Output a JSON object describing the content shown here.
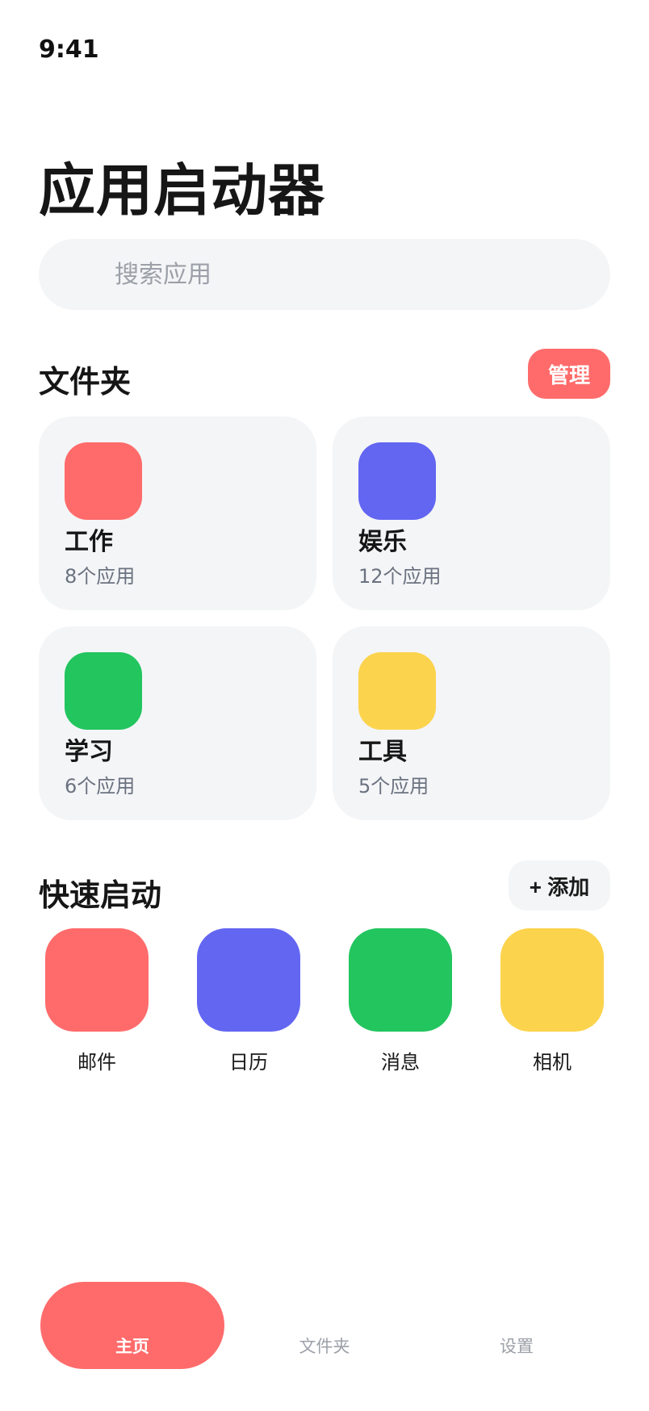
{
  "status_bar": {
    "time": "9:41"
  },
  "header": {
    "title": "应用启动器"
  },
  "search": {
    "placeholder": "搜索应用",
    "value": ""
  },
  "folders_section": {
    "title": "文件夹",
    "manage_label": "管理",
    "folders": [
      {
        "name": "工作",
        "count": "8个应用",
        "color": "#ff6b6b"
      },
      {
        "name": "娱乐",
        "count": "12个应用",
        "color": "#6366f1"
      },
      {
        "name": "学习",
        "count": "6个应用",
        "color": "#22c55e"
      },
      {
        "name": "工具",
        "count": "5个应用",
        "color": "#fcd34d"
      }
    ]
  },
  "quick_section": {
    "title": "快速启动",
    "add_label": "+ 添加",
    "apps": [
      {
        "name": "邮件",
        "color": "#ff6b6b"
      },
      {
        "name": "日历",
        "color": "#6366f1"
      },
      {
        "name": "消息",
        "color": "#22c55e"
      },
      {
        "name": "相机",
        "color": "#fcd34d"
      }
    ]
  },
  "tab_bar": {
    "tabs": [
      {
        "label": "主页",
        "active": true
      },
      {
        "label": "文件夹",
        "active": false
      },
      {
        "label": "设置",
        "active": false
      }
    ],
    "accent": "#ff6b6b"
  },
  "colors": {
    "accent": "#ff6b6b",
    "card_bg": "#f4f5f7",
    "muted_text": "#6b7280"
  }
}
